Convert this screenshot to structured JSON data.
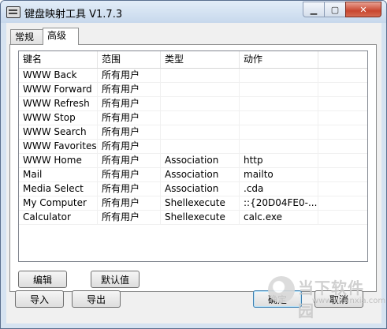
{
  "window": {
    "title": "键盘映射工具 V1.7.3",
    "min_glyph": "▁",
    "max_glyph": "▢",
    "close_glyph": "✕"
  },
  "tabs": [
    {
      "label": "常规",
      "active": false
    },
    {
      "label": "高级",
      "active": true
    }
  ],
  "list": {
    "columns": [
      "键名",
      "范围",
      "类型",
      "动作",
      ""
    ],
    "rows": [
      [
        "WWW Back",
        "所有用户",
        "",
        ""
      ],
      [
        "WWW Forward",
        "所有用户",
        "",
        ""
      ],
      [
        "WWW Refresh",
        "所有用户",
        "",
        ""
      ],
      [
        "WWW Stop",
        "所有用户",
        "",
        ""
      ],
      [
        "WWW Search",
        "所有用户",
        "",
        ""
      ],
      [
        "WWW Favorites",
        "所有用户",
        "",
        ""
      ],
      [
        "WWW Home",
        "所有用户",
        "Association",
        "http"
      ],
      [
        "Mail",
        "所有用户",
        "Association",
        "mailto"
      ],
      [
        "Media Select",
        "所有用户",
        "Association",
        ".cda"
      ],
      [
        "My Computer",
        "所有用户",
        "Shellexecute",
        "::{20D04FE0-..."
      ],
      [
        "Calculator",
        "所有用户",
        "Shellexecute",
        "calc.exe"
      ]
    ]
  },
  "panel_buttons": {
    "edit": "编辑",
    "default_value": "默认值"
  },
  "footer_buttons": {
    "import": "导入",
    "export": "导出",
    "ok": "确定",
    "cancel": "取消"
  },
  "watermark": {
    "brand": "当下软件园",
    "url": "www.downxia.com"
  }
}
